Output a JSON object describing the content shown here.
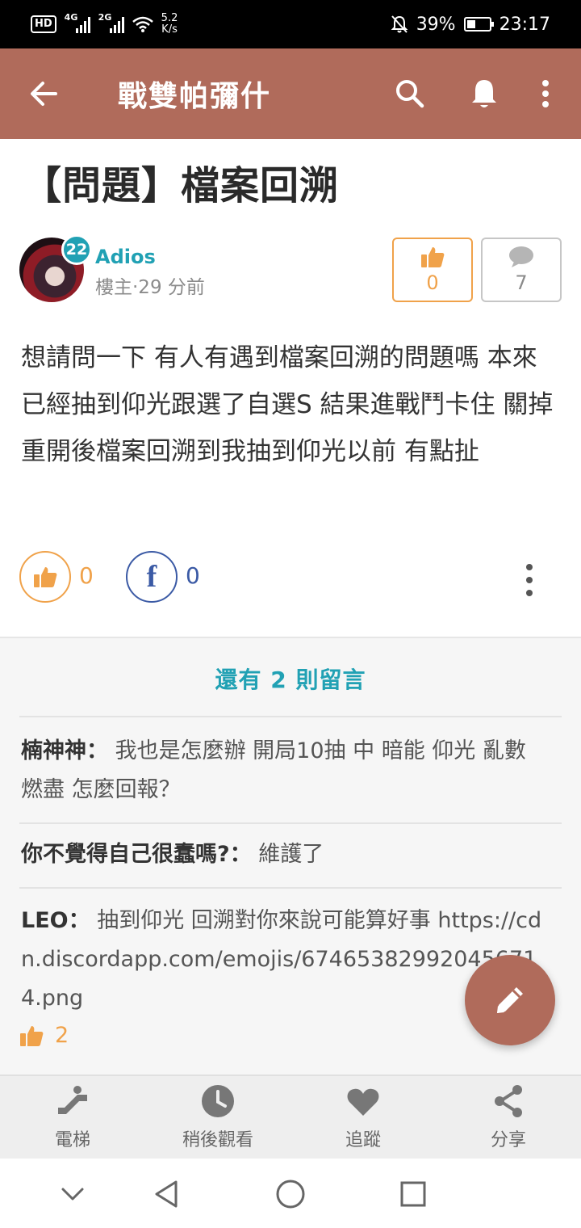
{
  "status_bar": {
    "hd": "HD",
    "net1": "4G",
    "net2": "2G",
    "speed_value": "5.2",
    "speed_unit": "K/s",
    "battery_pct": "39%",
    "battery_level": 0.39,
    "time": "23:17",
    "icons": [
      "hd-icon",
      "signal-icon",
      "wifi-icon",
      "mute-bell-icon",
      "battery-icon"
    ]
  },
  "app_bar": {
    "title": "戰雙帕彌什",
    "icons": [
      "back-arrow-icon",
      "search-icon",
      "bell-icon",
      "more-vert-icon"
    ],
    "background": "#b06b5b"
  },
  "post": {
    "title": "【問題】檔案回溯",
    "author": {
      "level": "22",
      "name": "Adios",
      "meta": "樓主‧29 分前"
    },
    "stats": {
      "likes": "0",
      "comments": "7"
    },
    "body": "想請問一下 有人有遇到檔案回溯的問題嗎 本來已經抽到仰光跟選了自選S 結果進戰鬥卡住 關掉重開後檔案回溯到我抽到仰光以前 有點扯",
    "actions": {
      "like_count": "0",
      "fb_label": "f",
      "share_count": "0"
    }
  },
  "comments": {
    "more_label": "還有 2 則留言",
    "items": [
      {
        "user": "楠神神：",
        "text": "我也是怎麼辦 開局10抽 中 暗能 仰光 亂數 燃盡 怎麼回報？"
      },
      {
        "user": "你不覺得自己很蠢嗎?：",
        "text": "維護了"
      },
      {
        "user": "LEO：",
        "text": "抽到仰光 回溯對你來說可能算好事 https://cdn.discordapp.com/emojis/674653829920456714.png",
        "likes": "2"
      }
    ]
  },
  "bottom_bar": {
    "items": [
      {
        "label": "電梯",
        "icon": "escalator-icon"
      },
      {
        "label": "稍後觀看",
        "icon": "clock-icon"
      },
      {
        "label": "追蹤",
        "icon": "heart-icon"
      },
      {
        "label": "分享",
        "icon": "share-icon"
      }
    ]
  },
  "colors": {
    "brand": "#b06b5b",
    "accent_teal": "#21a1b4",
    "like_orange": "#f0a24a",
    "facebook_blue": "#3b5aa5"
  }
}
